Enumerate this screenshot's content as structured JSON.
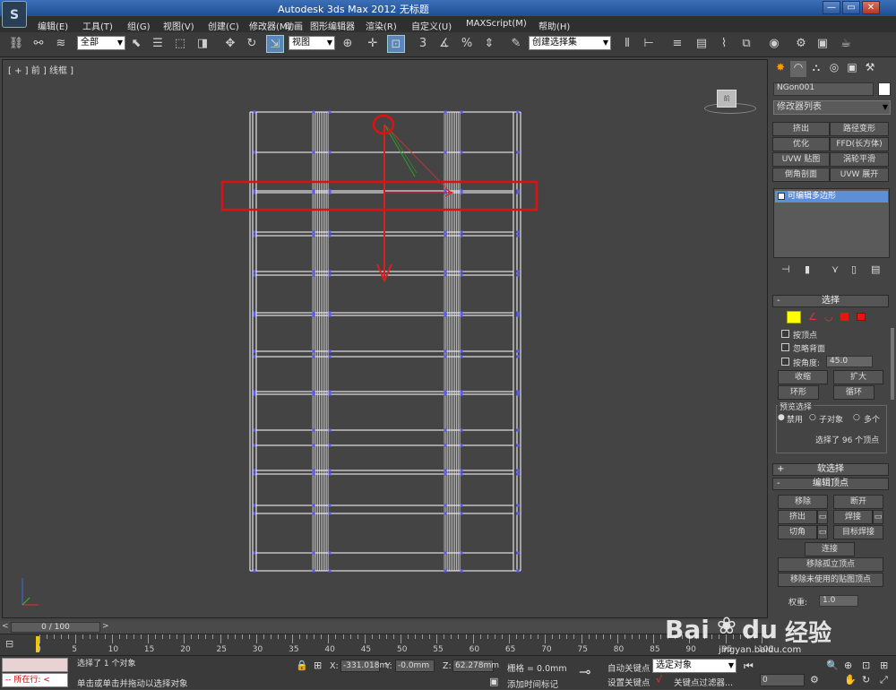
{
  "app": {
    "title": "Autodesk 3ds Max  2012    无标题",
    "window_buttons": [
      "—",
      "▭",
      "✕"
    ]
  },
  "menu": [
    "编辑(E)",
    "工具(T)",
    "组(G)",
    "视图(V)",
    "创建(C)",
    "修改器(M)",
    "动画",
    "图形编辑器",
    "渲染(R)",
    "自定义(U)",
    "MAXScript(M)",
    "帮助(H)"
  ],
  "toolbar": {
    "filter_value": "全部",
    "refcoord_value": "视图",
    "named_selection_placeholder": "创建选择集",
    "snap_label": "3",
    "percent_label": "%"
  },
  "viewport": {
    "label": "[ + ] 前 ] 线框 ]",
    "viewcube_label": "前"
  },
  "panel": {
    "object_name": "NGon001",
    "modifier_list": "修改器列表",
    "modifier_buttons": [
      "挤出",
      "路径变形",
      "优化",
      "FFD(长方体)",
      "UVW 贴图",
      "涡轮平滑",
      "倒角剖面",
      "UVW 展开"
    ],
    "stack_item": "可编辑多边形",
    "selection": {
      "header": "选择",
      "by_vertex": "按顶点",
      "ignore_backfacing": "忽略背面",
      "by_angle": "按角度:",
      "angle_value": "45.0",
      "shrink": "收缩",
      "grow": "扩大",
      "ring": "环形",
      "loop": "循环",
      "preview_label": "预览选择",
      "preview_off": "禁用",
      "preview_sub": "子对象",
      "preview_multi": "多个",
      "status": "选择了 96 个顶点"
    },
    "soft_selection": "软选择",
    "edit_vertices": {
      "header": "编辑顶点",
      "remove": "移除",
      "break": "断开",
      "extrude": "挤出",
      "weld": "焊接",
      "chamfer": "切角",
      "target_weld": "目标焊接",
      "connect": "连接",
      "remove_isolated": "移除孤立顶点",
      "remove_unused_map": "移除未使用的贴图顶点",
      "weight_label": "权重:",
      "weight_value": "1.0"
    }
  },
  "timeline": {
    "frame_counter": "0 / 100",
    "ticks": [
      0,
      5,
      10,
      15,
      20,
      25,
      30,
      35,
      40,
      45,
      50,
      55,
      60,
      65,
      70,
      75,
      80,
      85,
      90,
      95,
      100
    ]
  },
  "status": {
    "running_label": "所在行:",
    "message1": "选择了 1 个对象",
    "message2": "单击或单击并拖动以选择对象",
    "x_label": "X:",
    "x_value": "-331.018m",
    "y_label": "Y:",
    "y_value": "-0.0mm",
    "z_label": "Z:",
    "z_value": "62.278mm",
    "grid": "栅格 = 0.0mm",
    "add_time_tag": "添加时间标记",
    "auto_key": "自动关键点",
    "set_key": "设置关键点",
    "selected_object": "选定对象",
    "key_filters": "关键点过滤器...",
    "frame_field": "0"
  },
  "watermark": {
    "brand": "Bai",
    "brand2": "du",
    "cn": "经验",
    "url": "jingyan.baidu.com"
  }
}
